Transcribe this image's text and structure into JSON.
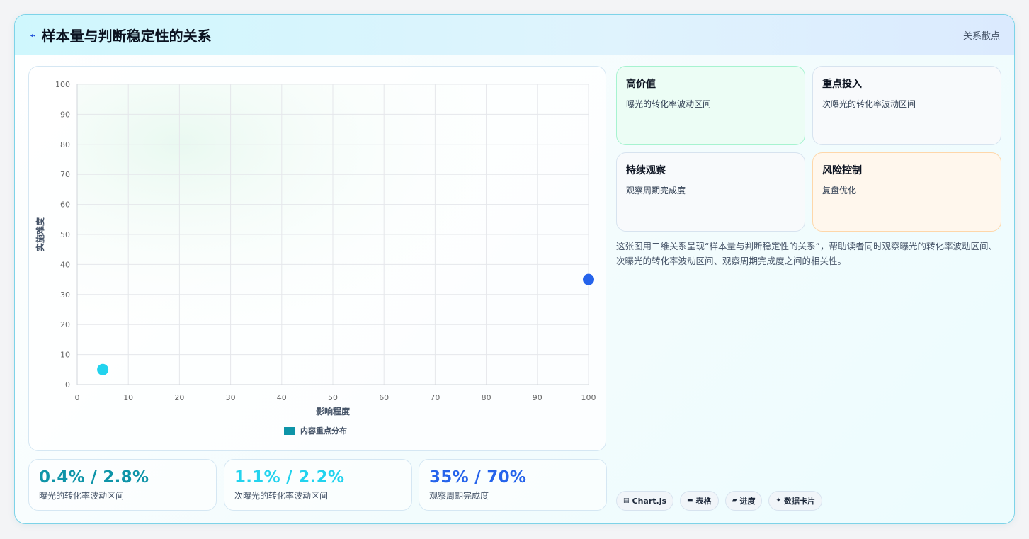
{
  "header": {
    "icon": "wave-icon",
    "title": "样本量与判断稳定性的关系",
    "tag": "关系散点"
  },
  "chart_data": {
    "type": "scatter",
    "title": "",
    "xlabel": "影响程度",
    "ylabel": "实施难度",
    "xlim": [
      0,
      100
    ],
    "ylim": [
      0,
      100
    ],
    "xticks": [
      0,
      10,
      20,
      30,
      40,
      50,
      60,
      70,
      80,
      90,
      100
    ],
    "yticks": [
      0,
      10,
      20,
      30,
      40,
      50,
      60,
      70,
      80,
      90,
      100
    ],
    "grid": true,
    "legend_position": "bottom",
    "legend_color": "#0e94a8",
    "series": [
      {
        "name": "内容重点分布",
        "points": [
          {
            "x": 5,
            "y": 5,
            "color": "#22d3ee"
          },
          {
            "x": 100,
            "y": 35,
            "color": "#2563eb"
          }
        ]
      }
    ]
  },
  "kpis": [
    {
      "value": "0.4% / 2.8%",
      "label": "曝光的转化率波动区间",
      "color": "#0e94a8"
    },
    {
      "value": "1.1% / 2.2%",
      "label": "次曝光的转化率波动区间",
      "color": "#22d3ee"
    },
    {
      "value": "35% / 70%",
      "label": "观察周期完成度",
      "color": "#2563eb"
    }
  ],
  "quadrants": [
    {
      "title": "高价值",
      "desc": "曝光的转化率波动区间",
      "bg": "#ecfdf5",
      "border": "#a7f3d0"
    },
    {
      "title": "重点投入",
      "desc": "次曝光的转化率波动区间",
      "bg": "#f8fafc",
      "border": "#d7e3ef"
    },
    {
      "title": "持续观察",
      "desc": "观察周期完成度",
      "bg": "#f8fafc",
      "border": "#d7e3ef"
    },
    {
      "title": "风险控制",
      "desc": "复盘优化",
      "bg": "#fff7ed",
      "border": "#fed7aa"
    }
  ],
  "description": "这张图用二维关系呈现“样本量与判断稳定性的关系”，帮助读者同时观察曝光的转化率波动区间、次曝光的转化率波动区间、观察周期完成度之间的相关性。",
  "chips": [
    {
      "icon": "chart-icon",
      "glyph": "▤",
      "label": "Chart.js"
    },
    {
      "icon": "table-icon",
      "glyph": "▬",
      "label": "表格"
    },
    {
      "icon": "progress-icon",
      "glyph": "▰",
      "label": "进度"
    },
    {
      "icon": "sparkle-icon",
      "glyph": "✦",
      "label": "数据卡片"
    }
  ]
}
